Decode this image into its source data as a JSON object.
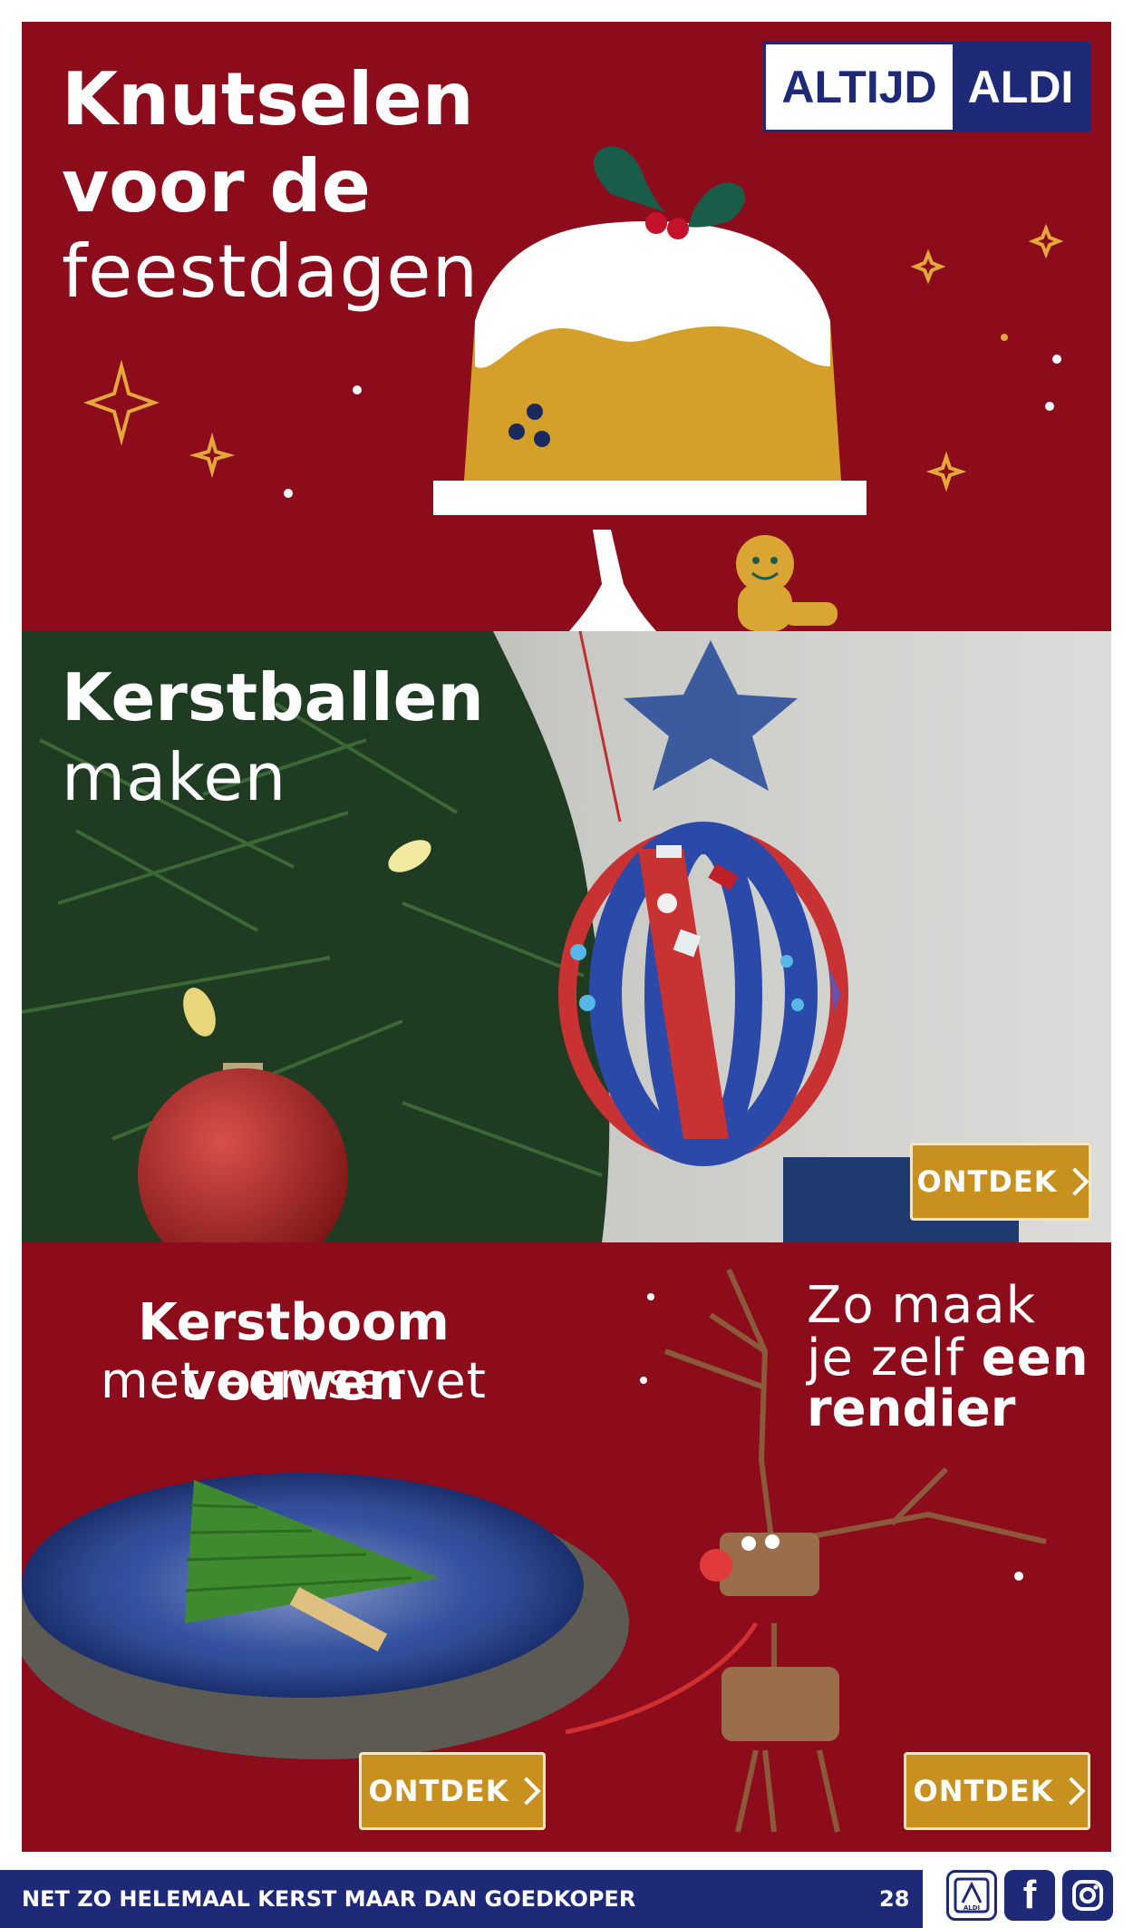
{
  "brand": {
    "logo_left": "ALTIJD",
    "logo_right": "ALDI",
    "colors": {
      "red": "#8c0c1b",
      "navy": "#1e2a78",
      "gold": "#c8911f",
      "white": "#ffffff"
    }
  },
  "top": {
    "title_line1": "Knutselen",
    "title_line2": "voor de",
    "title_line3": "feestdagen"
  },
  "mid": {
    "title_line1": "Kerstballen",
    "title_line2": "maken",
    "cta_label": "ONTDEK"
  },
  "bottom": {
    "left_title_line1": "Kerstboom vouwen",
    "left_title_line2": "met een servet",
    "left_cta_label": "ONTDEK",
    "right_line1": "Zo maak",
    "right_line2_pre": "je zelf ",
    "right_line2_bold": "een",
    "right_line3": "rendier",
    "right_cta_label": "ONTDEK"
  },
  "footer": {
    "tagline": "NET ZO HELEMAAL KERST MAAR DAN GOEDKOPER",
    "page_number": "28",
    "aldi_badge": "ALDI",
    "facebook_glyph": "f",
    "icons": [
      "aldi-icon",
      "facebook-icon",
      "instagram-icon"
    ]
  }
}
